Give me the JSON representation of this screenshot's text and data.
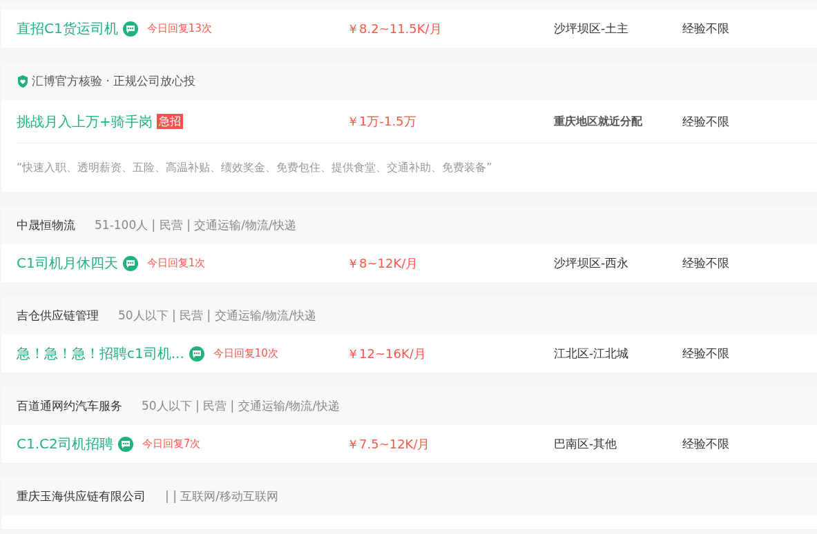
{
  "jobs": [
    {
      "title": "直招C1货运司机",
      "chat": true,
      "reply": "今日回复13次",
      "salary": "￥8.2~11.5K/月",
      "location": "沙坪坝区-土主",
      "experience": "经验不限"
    },
    {
      "header": {
        "kind": "verified",
        "text": "汇博官方核验 · 正规公司放心投"
      },
      "title": "挑战月入上万+骑手岗",
      "tag": {
        "kind": "urgent",
        "text": "急招"
      },
      "chat": false,
      "salary": "￥1万-1.5万",
      "location": "重庆地区就近分配",
      "location_bold": true,
      "experience": "经验不限",
      "description": "“快速入职、透明薪资、五险、高温补贴、绩效奖金、免费包住、提供食堂、交通补助、免费装备”"
    },
    {
      "header": {
        "kind": "company",
        "name": "中晟恒物流",
        "info": "51-100人 | 民营 | 交通运输/物流/快递"
      },
      "title": "C1司机月休四天",
      "chat": true,
      "reply": "今日回复1次",
      "salary": "￥8~12K/月",
      "location": "沙坪坝区-西永",
      "experience": "经验不限"
    },
    {
      "header": {
        "kind": "company",
        "name": "吉仓供应链管理",
        "info": "50人以下 | 民营 | 交通运输/物流/快递"
      },
      "title": "急！急！急！招聘c1司机...",
      "chat": true,
      "reply": "今日回复10次",
      "salary": "￥12~16K/月",
      "location": "江北区-江北城",
      "experience": "经验不限"
    },
    {
      "header": {
        "kind": "company",
        "name": "百道通网约汽车服务",
        "info": "50人以下 | 民营 | 交通运输/物流/快递"
      },
      "title": "C1.C2司机招聘",
      "chat": true,
      "reply": "今日回复7次",
      "salary": "￥7.5~12K/月",
      "location": "巴南区-其他",
      "experience": "经验不限"
    },
    {
      "header": {
        "kind": "company",
        "name": "重庆玉海供应链有限公司",
        "info": "| | 互联网/移动互联网"
      }
    }
  ]
}
